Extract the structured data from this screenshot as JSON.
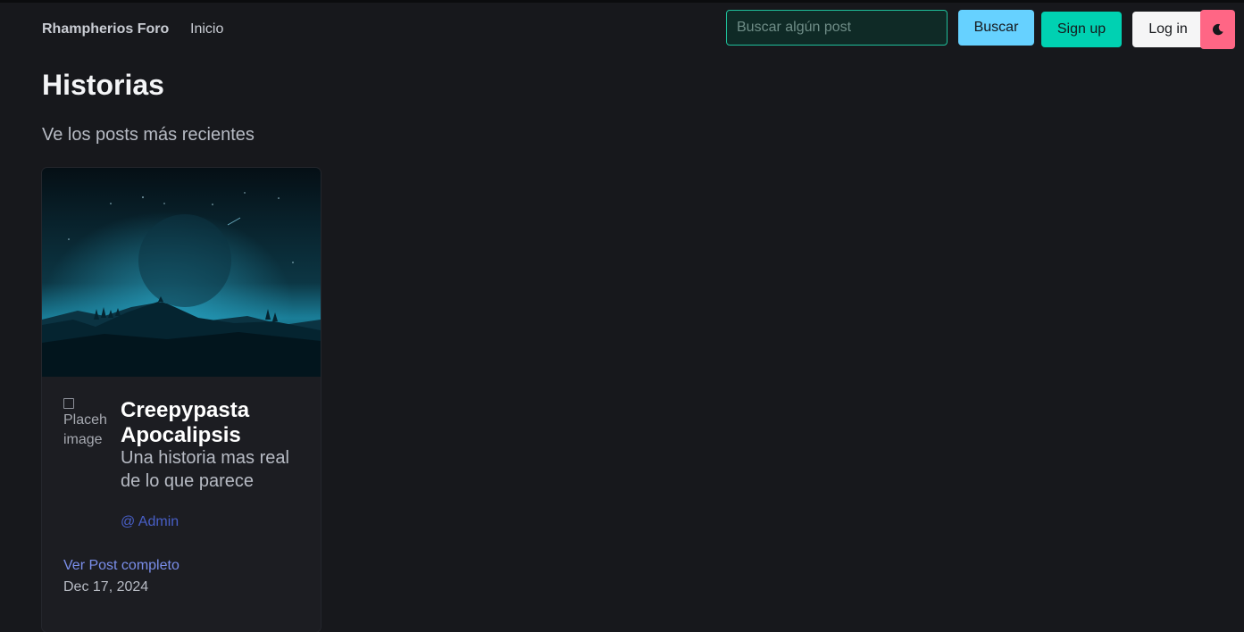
{
  "navbar": {
    "brand": "Rhampherios Foro",
    "links": [
      "Inicio"
    ],
    "search_placeholder": "Buscar algún post",
    "search_value": "",
    "search_button": "Buscar",
    "signup_button": "Sign up",
    "login_button": "Log in",
    "theme_toggle_icon": "moon-icon"
  },
  "page": {
    "title": "Historias",
    "subtitle": "Ve los posts más recientes"
  },
  "posts": [
    {
      "image_icon": "night-landscape-image",
      "avatar_alt": "Placeholder image",
      "title": "Creepypasta Apocalipsis",
      "description": "Una historia mas real de lo que parece",
      "author": "@ Admin",
      "read_more": "Ver Post completo",
      "date": "Dec 17, 2024"
    }
  ],
  "colors": {
    "background": "#17181c",
    "accent_primary": "#00d1b2",
    "accent_info": "#66d1ff",
    "accent_danger": "#ff6685",
    "link": "#485fc7"
  }
}
